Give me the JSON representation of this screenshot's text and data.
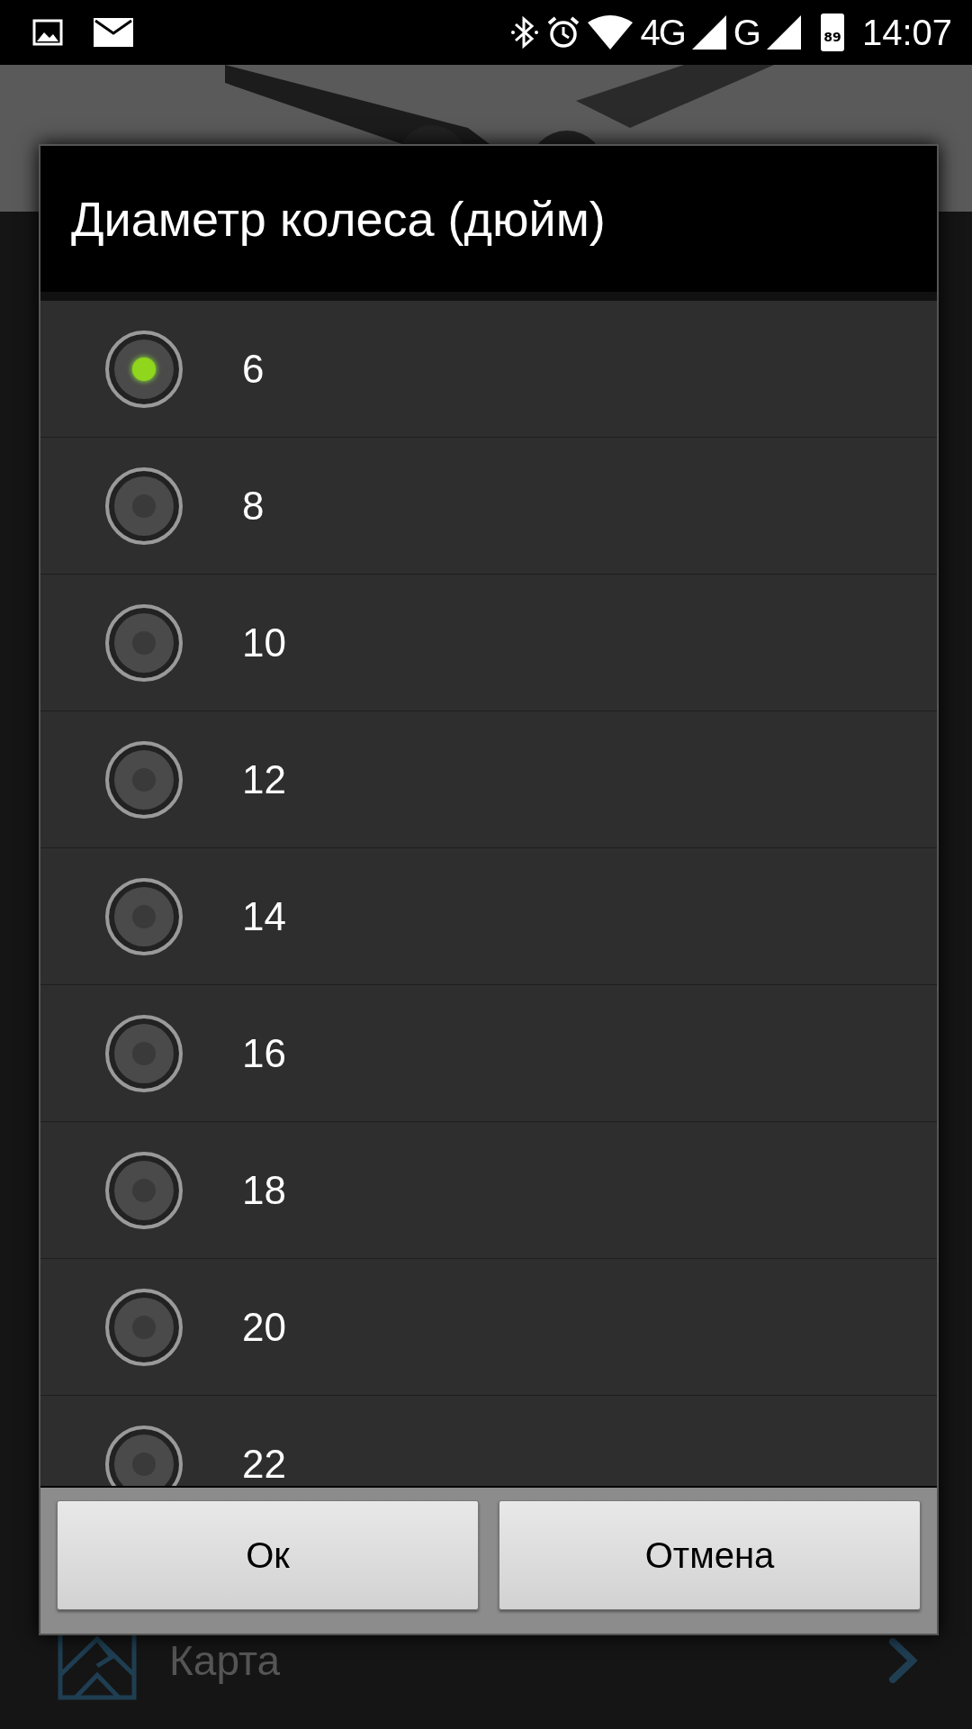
{
  "status_bar": {
    "network_labels": [
      "4G",
      "G"
    ],
    "battery": "89",
    "time": "14:07"
  },
  "background": {
    "menu_item": "Карта"
  },
  "dialog": {
    "title": "Диаметр колеса (дюйм)",
    "options": [
      {
        "label": "6",
        "selected": true
      },
      {
        "label": "8",
        "selected": false
      },
      {
        "label": "10",
        "selected": false
      },
      {
        "label": "12",
        "selected": false
      },
      {
        "label": "14",
        "selected": false
      },
      {
        "label": "16",
        "selected": false
      },
      {
        "label": "18",
        "selected": false
      },
      {
        "label": "20",
        "selected": false
      },
      {
        "label": "22",
        "selected": false
      }
    ],
    "buttons": [
      "Ок",
      "Отмена"
    ]
  }
}
